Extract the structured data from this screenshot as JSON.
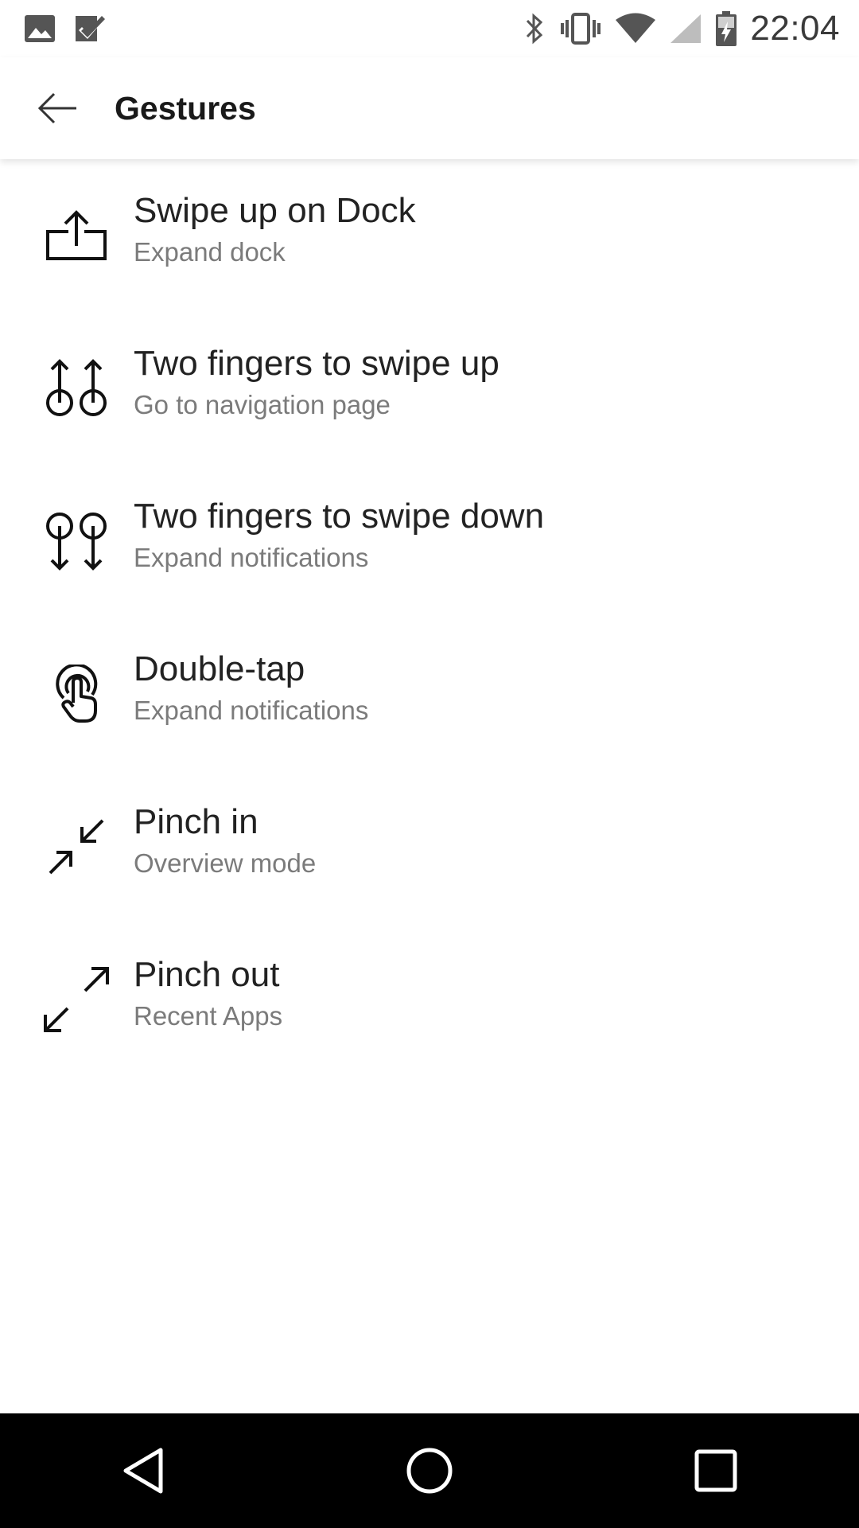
{
  "status_bar": {
    "time": "22:04",
    "icons": [
      "image-icon",
      "check-badge-icon",
      "bluetooth-icon",
      "vibrate-icon",
      "wifi-icon",
      "signal-icon",
      "battery-charging-icon"
    ]
  },
  "header": {
    "title": "Gestures",
    "back_icon": "arrow-left-icon"
  },
  "gestures": [
    {
      "icon": "swipe-up-dock-icon",
      "title": "Swipe up on Dock",
      "action": "Expand dock"
    },
    {
      "icon": "two-finger-swipe-up-icon",
      "title": "Two fingers to swipe up",
      "action": "Go to navigation page"
    },
    {
      "icon": "two-finger-swipe-down-icon",
      "title": "Two fingers to swipe down",
      "action": "Expand notifications"
    },
    {
      "icon": "double-tap-icon",
      "title": "Double-tap",
      "action": "Expand notifications"
    },
    {
      "icon": "pinch-in-icon",
      "title": "Pinch in",
      "action": "Overview mode"
    },
    {
      "icon": "pinch-out-icon",
      "title": "Pinch out",
      "action": "Recent Apps"
    }
  ],
  "nav_bar": {
    "icons": [
      "back-triangle-icon",
      "home-circle-icon",
      "recents-square-icon"
    ]
  },
  "colors": {
    "text_primary": "#222222",
    "text_secondary": "#7b7b7b",
    "nav_background": "#000000"
  }
}
